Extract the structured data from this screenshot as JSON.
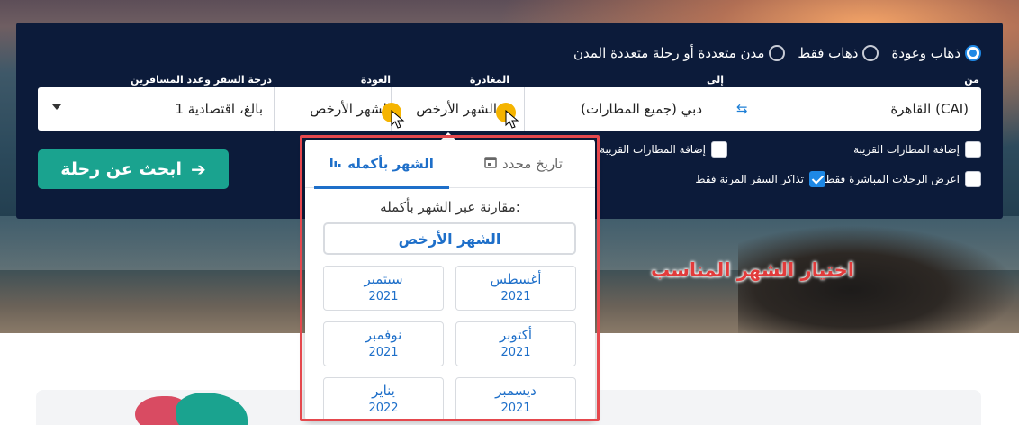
{
  "trip_type": {
    "options": [
      {
        "label": "ذهاب وعودة",
        "selected": true
      },
      {
        "label": "ذهاب فقط",
        "selected": false
      },
      {
        "label": "مدن متعددة أو رحلة متعددة المدن",
        "selected": false
      }
    ]
  },
  "labels": {
    "from": "من",
    "to": "إلى",
    "departure": "المغادرة",
    "return": "العودة",
    "class_passengers": "درجة السفر وعدد المسافرين"
  },
  "fields": {
    "from_value": "القاهرة (CAI)",
    "to_value": "دبي (جميع المطارات)",
    "departure_value": "الشهر الأرخص",
    "return_value": "الشهر الأرخص",
    "class_value": "1 بالغ، اقتصادية"
  },
  "checkboxes": {
    "nearby_from": {
      "label": "إضافة المطارات القريبة",
      "checked": false
    },
    "nearby_to": {
      "label": "إضافة المطارات القريبة",
      "checked": false
    },
    "direct_only": {
      "label": "اعرض الرحلات المباشرة فقط",
      "checked": false
    },
    "flexible_only": {
      "label": "تذاكر السفر المرنة فقط",
      "checked": true
    }
  },
  "search_button": {
    "label": "ابحث عن رحلة"
  },
  "dropdown": {
    "tab_specific": "تاريخ محدد",
    "tab_month": "الشهر بأكمله",
    "compare_text": "مقارنة عبر الشهر بأكمله:",
    "cheapest_label": "الشهر الأرخص",
    "months": [
      {
        "name": "أغسطس",
        "year": "2021"
      },
      {
        "name": "سبتمبر",
        "year": "2021"
      },
      {
        "name": "أكتوبر",
        "year": "2021"
      },
      {
        "name": "نوفمبر",
        "year": "2021"
      },
      {
        "name": "ديسمبر",
        "year": "2021"
      },
      {
        "name": "يناير",
        "year": "2022"
      }
    ]
  },
  "annotation": "اختيار الشهر المناسب",
  "colors": {
    "panel": "#0c1b3a",
    "accent_blue": "#1e6fc9",
    "search_teal": "#1aa38f",
    "highlight_red": "#e5484d"
  }
}
